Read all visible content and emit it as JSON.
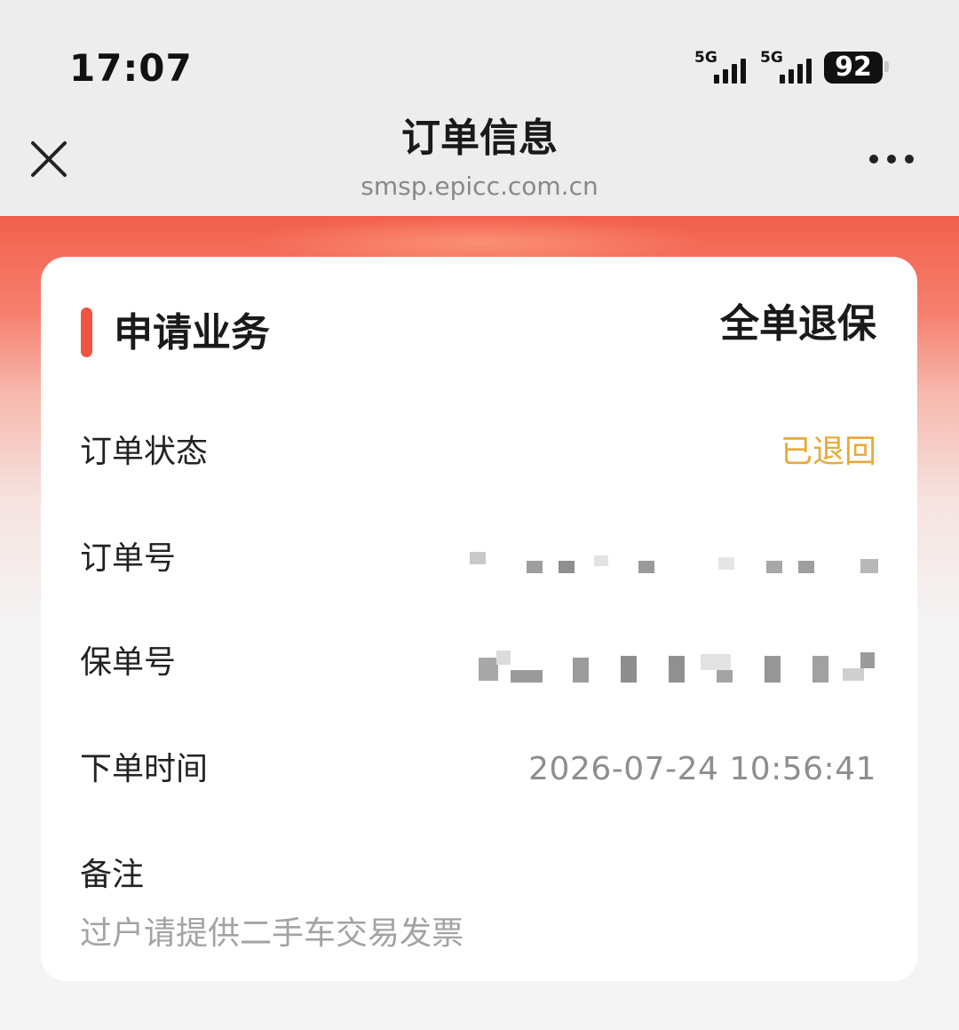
{
  "status_bar": {
    "time": "17:07",
    "signal_1_label": "5G",
    "signal_2_label": "5G",
    "battery_level": "92"
  },
  "nav": {
    "title": "订单信息",
    "url": "smsp.epicc.com.cn",
    "close_icon": "close-icon",
    "more_icon": "more-icon"
  },
  "card": {
    "section_title": "申请业务",
    "business_type": "全单退保",
    "rows": [
      {
        "label": "订单状态",
        "value": "已退回"
      },
      {
        "label": "订单号",
        "value": "[redacted]"
      },
      {
        "label": "保单号",
        "value": "[redacted]"
      },
      {
        "label": "下单时间",
        "value": "2026-07-24 10:56:41"
      }
    ],
    "remark_label": "备注",
    "remark_value": "过户请提供二手车交易发票"
  },
  "colors": {
    "accent_red": "#f05542",
    "status_orange": "#e9a938",
    "header_gradient_top": "#f2604b"
  }
}
